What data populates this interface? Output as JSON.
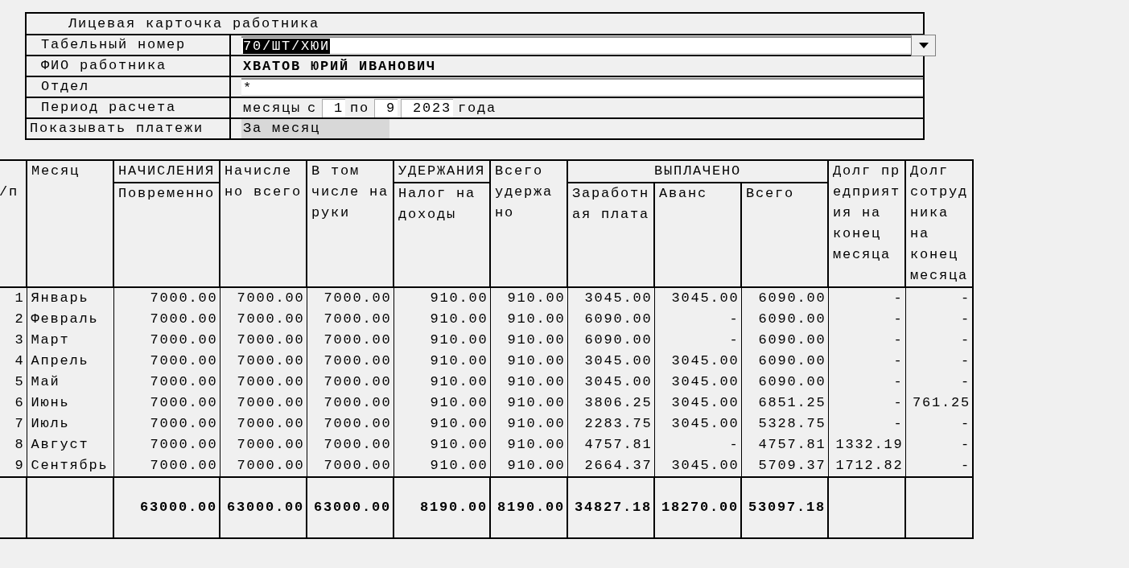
{
  "form": {
    "title": "Лицевая карточка работника",
    "fields": [
      {
        "kind": "combo",
        "label": "Табельный номер",
        "value": "70/ШТ/ХЮИ",
        "selected": true
      },
      {
        "kind": "text",
        "label": "ФИО работника",
        "value": "ХВАТОВ ЮРИЙ ИВАНОВИЧ"
      },
      {
        "kind": "input",
        "label": "Отдел",
        "value": "*"
      },
      {
        "kind": "period",
        "label": "Период расчета",
        "parts": [
          {
            "kind": "text",
            "text": "месяцы"
          },
          {
            "kind": "text",
            "text": "с"
          },
          {
            "kind": "input",
            "value": "1"
          },
          {
            "kind": "text",
            "text": "по"
          },
          {
            "kind": "input",
            "value": "9"
          },
          {
            "kind": "input",
            "value": "2023"
          },
          {
            "kind": "text",
            "text": "года"
          }
        ]
      },
      {
        "kind": "select",
        "label": "Показывать платежи",
        "value": "За месяц"
      }
    ]
  },
  "table": {
    "columns": [
      {
        "header": "\n/п"
      },
      {
        "header": "Месяц"
      },
      {
        "group": "НАЧИСЛЕНИЯ",
        "children": [
          {
            "header": "Повременно"
          }
        ]
      },
      {
        "header": "Начисле\nно всего"
      },
      {
        "header": "В том\nчисле на\nруки"
      },
      {
        "group": "УДЕРЖАНИЯ",
        "children": [
          {
            "header": "Налог на\nдоходы"
          }
        ]
      },
      {
        "header": "Всего\nудержа\nно"
      },
      {
        "group": "ВЫПЛАЧЕНО",
        "colspan": 3,
        "children": [
          {
            "header": "Заработн\nая плата"
          },
          {
            "header": "Аванс"
          },
          {
            "header": "Всего"
          }
        ]
      },
      {
        "header": "Долг пр\nедприят\nия на\nконец\nмесяца"
      },
      {
        "header": "Долг\nсотруд\nника\nна\nконец\nмесяца"
      }
    ],
    "rows": [
      [
        "1",
        "Январь",
        "7000.00",
        "7000.00",
        "7000.00",
        "910.00",
        "910.00",
        "3045.00",
        "3045.00",
        "6090.00",
        "-",
        "-"
      ],
      [
        "2",
        "Февраль",
        "7000.00",
        "7000.00",
        "7000.00",
        "910.00",
        "910.00",
        "6090.00",
        "-",
        "6090.00",
        "-",
        "-"
      ],
      [
        "3",
        "Март",
        "7000.00",
        "7000.00",
        "7000.00",
        "910.00",
        "910.00",
        "6090.00",
        "-",
        "6090.00",
        "-",
        "-"
      ],
      [
        "4",
        "Апрель",
        "7000.00",
        "7000.00",
        "7000.00",
        "910.00",
        "910.00",
        "3045.00",
        "3045.00",
        "6090.00",
        "-",
        "-"
      ],
      [
        "5",
        "Май",
        "7000.00",
        "7000.00",
        "7000.00",
        "910.00",
        "910.00",
        "3045.00",
        "3045.00",
        "6090.00",
        "-",
        "-"
      ],
      [
        "6",
        "Июнь",
        "7000.00",
        "7000.00",
        "7000.00",
        "910.00",
        "910.00",
        "3806.25",
        "3045.00",
        "6851.25",
        "-",
        "761.25"
      ],
      [
        "7",
        "Июль",
        "7000.00",
        "7000.00",
        "7000.00",
        "910.00",
        "910.00",
        "2283.75",
        "3045.00",
        "5328.75",
        "-",
        "-"
      ],
      [
        "8",
        "Август",
        "7000.00",
        "7000.00",
        "7000.00",
        "910.00",
        "910.00",
        "4757.81",
        "-",
        "4757.81",
        "1332.19",
        "-"
      ],
      [
        "9",
        "Сентябрь",
        "7000.00",
        "7000.00",
        "7000.00",
        "910.00",
        "910.00",
        "2664.37",
        "3045.00",
        "5709.37",
        "1712.82",
        "-"
      ]
    ],
    "totals": [
      "63000.00",
      "63000.00",
      "63000.00",
      "8190.00",
      "8190.00",
      "34827.18",
      "18270.00",
      "53097.18"
    ]
  }
}
